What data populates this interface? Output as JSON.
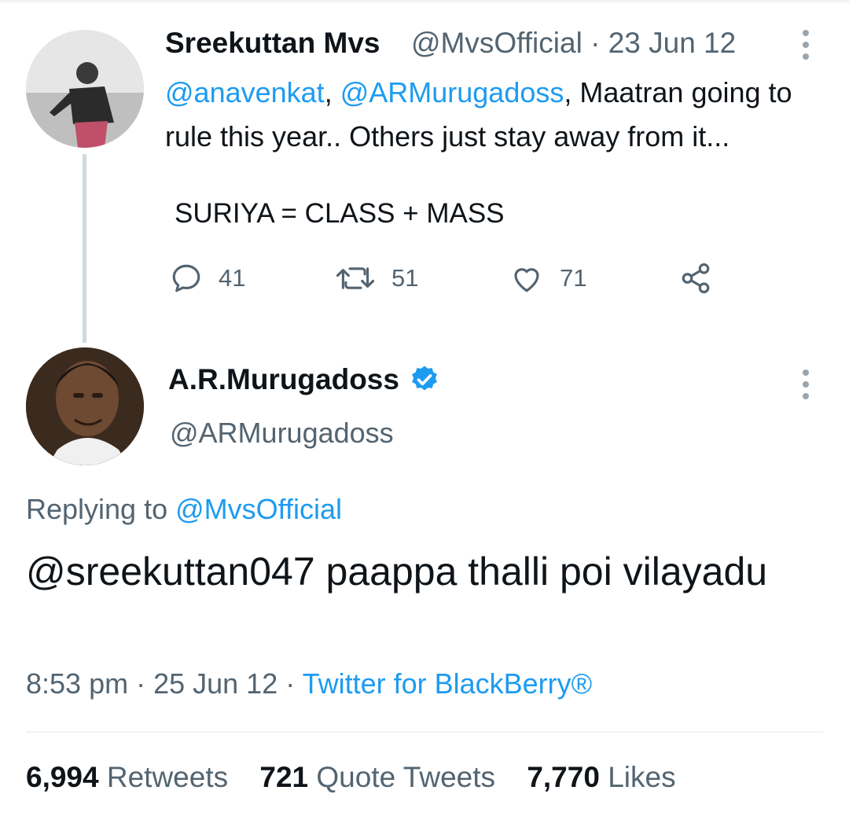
{
  "tweet1": {
    "author_name": "Sreekuttan Mvs",
    "handle": "@MvsOfficial",
    "date_sep": "·",
    "date": "23 Jun 12",
    "mention1": "@anavenkat",
    "sep1": ", ",
    "mention2": "@ARMurugadoss",
    "text_rest": ", Maatran going to rule this year.. Others just stay away from it...",
    "text_line2": "SURIYA = CLASS + MASS",
    "replies": "41",
    "retweets": "51",
    "likes": "71",
    "icons": [
      "reply-icon",
      "retweet-icon",
      "like-icon",
      "share-icon"
    ]
  },
  "tweet2": {
    "author_name": "A.R.Murugadoss",
    "verified_icon": "verified-badge-icon",
    "handle": "@ARMurugadoss",
    "replying_prefix": "Replying to ",
    "replying_to": "@MvsOfficial",
    "text": "@sreekuttan047 paappa thalli poi vilayadu",
    "time": "8:53 pm",
    "sep": " · ",
    "date": "25 Jun 12",
    "sep2": " · ",
    "source": "Twitter for BlackBerry®"
  },
  "stats": {
    "retweets_count": "6,994",
    "retweets_label": "Retweets",
    "quotes_count": "721",
    "quotes_label": "Quote Tweets",
    "likes_count": "7,770",
    "likes_label": "Likes"
  },
  "colors": {
    "link": "#1d9bf0",
    "secondary_text": "#536471",
    "primary_text": "#0f1419",
    "thread_line": "#cfd9de"
  }
}
